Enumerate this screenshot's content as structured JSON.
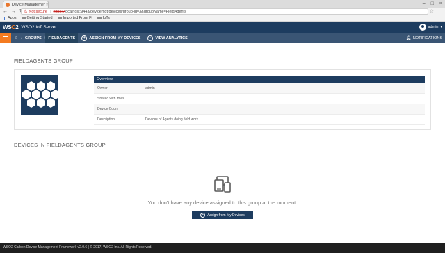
{
  "browser": {
    "tab_title": "Device Management",
    "tab_close": "×",
    "window_controls": [
      "–",
      "□",
      "×"
    ],
    "nav_icons": [
      "←",
      "→",
      "↻"
    ],
    "not_secure": "Not secure",
    "url_scheme": "https://",
    "url_rest": "localhost:9443/devicemgt/devices/group-id=3&groupName=FieldAgents",
    "bookmarks": [
      "Apps",
      "Getting Started",
      "Imported From Fi",
      "IoTs"
    ]
  },
  "header": {
    "logo_ws": "WS",
    "logo_o": "O",
    "logo_2": "2",
    "title": "WSO2 IoT Server",
    "user": "admin"
  },
  "nav": {
    "breadcrumb": [
      "GROUPS",
      "FIELDAGENTS"
    ],
    "assign_label": "ASSIGN FROM MY DEVICES",
    "analytics_label": "VIEW ANALYTICS",
    "notifications_label": "NOTIFICATIONS"
  },
  "group": {
    "heading": "FIELDAGENTS GROUP",
    "overview_title": "Overview",
    "rows": [
      {
        "label": "Owner",
        "value": "admin"
      },
      {
        "label": "Shared with roles",
        "value": ""
      },
      {
        "label": "Device Count",
        "value": ""
      },
      {
        "label": "Description",
        "value": "Devices of Agents doing field work"
      }
    ]
  },
  "devices": {
    "heading": "DEVICES IN FIELDAGENTS GROUP",
    "empty_message": "You don't have any device assigned to this group at the moment.",
    "assign_button": "Assign from My Devices"
  },
  "footer": {
    "text": "WSO2 Carbon Device Management Framework v2.0.6 | © 2017, WSO2 Inc. All Rights Reserved."
  },
  "colors": {
    "brand_dark": "#1d3c5f",
    "nav_bar": "#3a5574",
    "accent_orange": "#f47b20",
    "footer": "#1f1f1f"
  }
}
